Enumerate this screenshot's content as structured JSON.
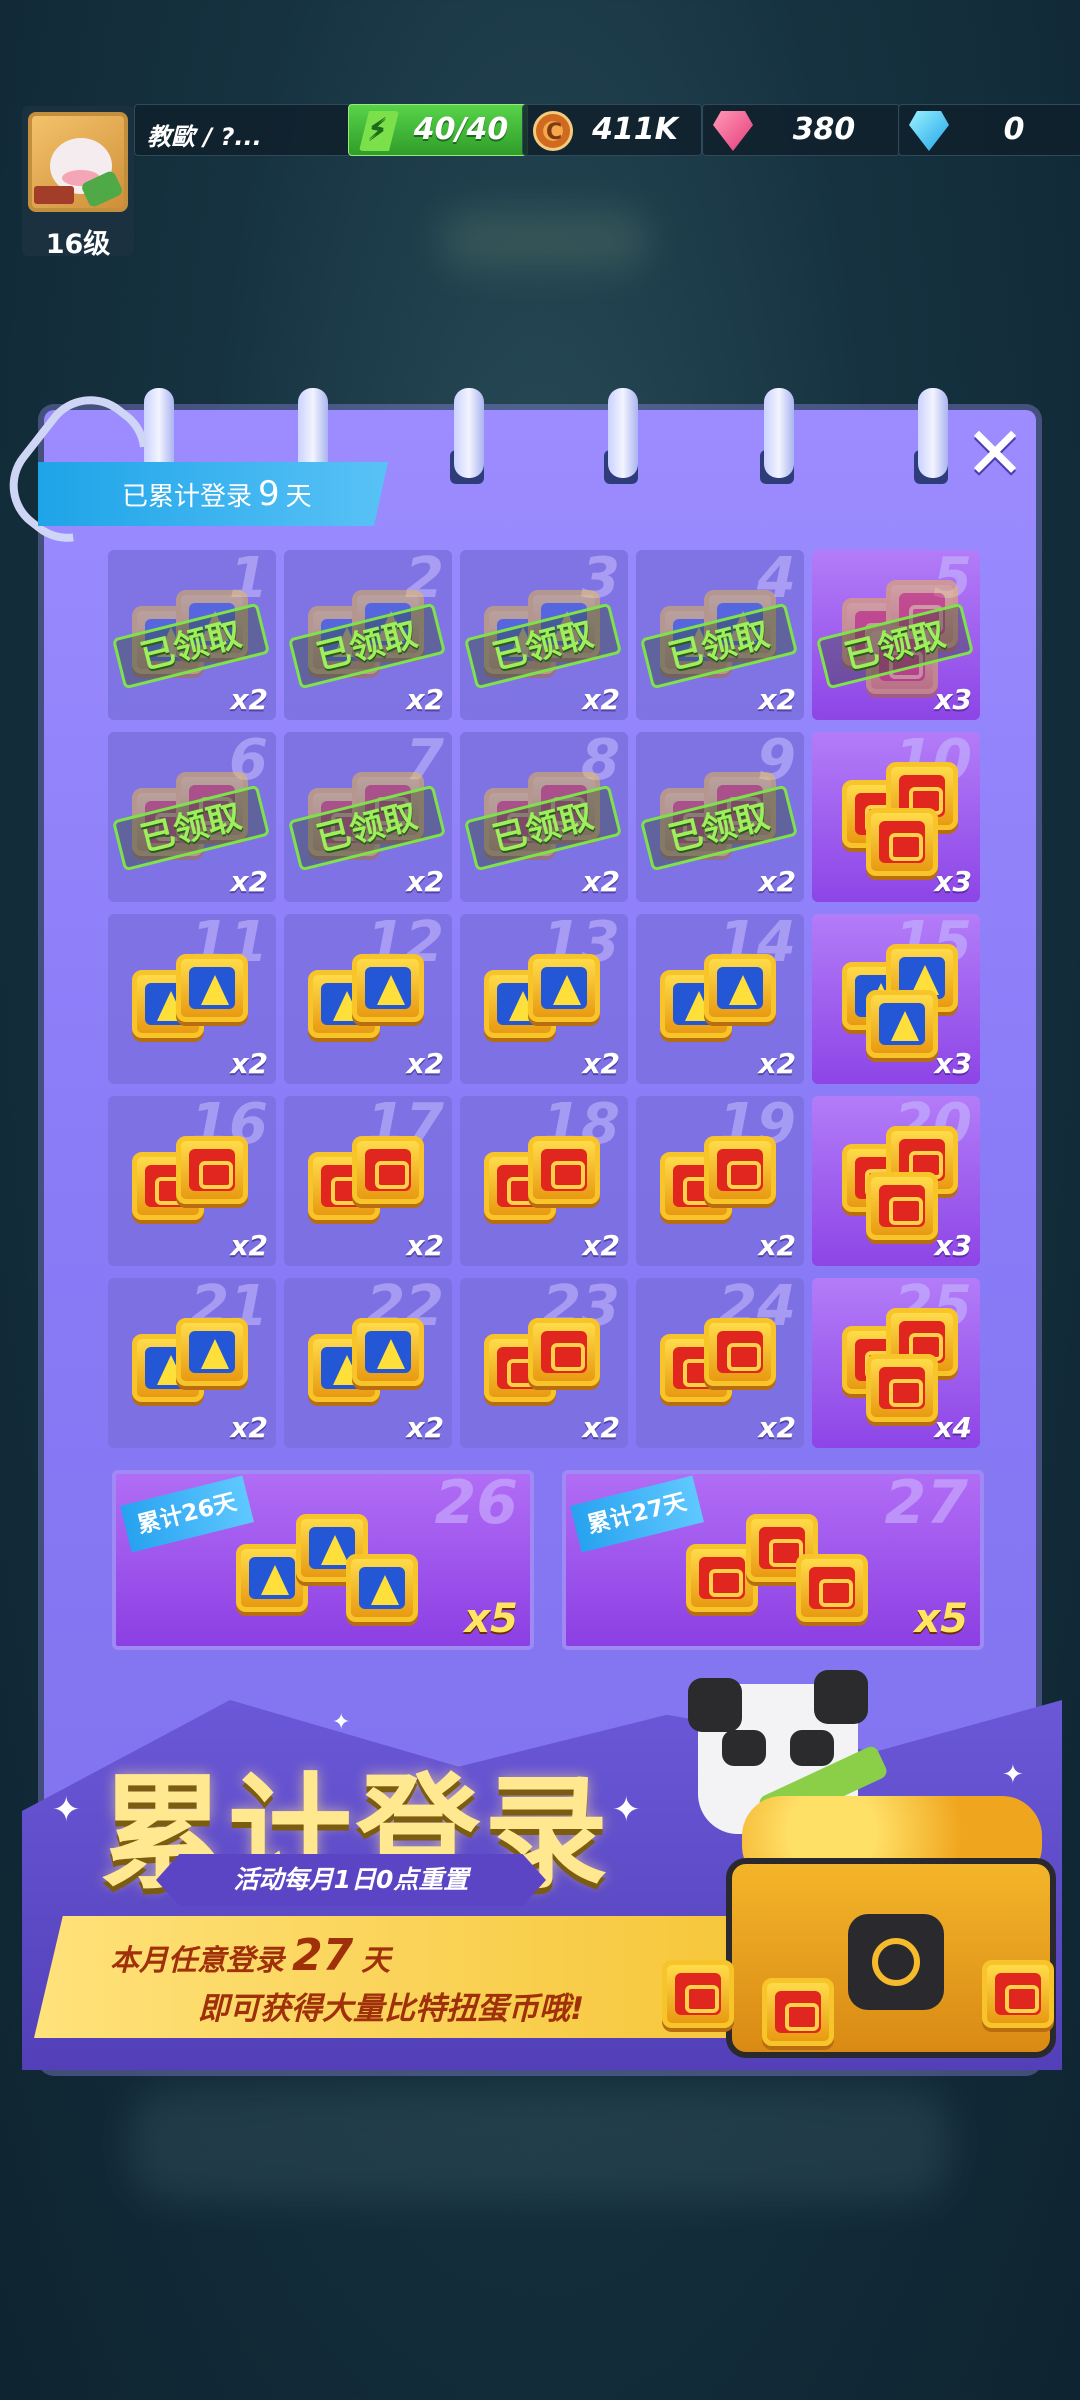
{
  "hud": {
    "player_name": "教歐 / ?...",
    "level": "16级",
    "energy": "40/40",
    "coins": "411K",
    "gems": "380",
    "diamonds": "0"
  },
  "panel": {
    "login_label_prefix": "已累计登录",
    "login_days": "9",
    "login_label_suffix": "天",
    "close_symbol": "✕",
    "claimed_label": "已领取",
    "days": [
      {
        "day": "1",
        "qty": "x2",
        "box": "blue",
        "claimed": true,
        "special": false
      },
      {
        "day": "2",
        "qty": "x2",
        "box": "blue",
        "claimed": true,
        "special": false
      },
      {
        "day": "3",
        "qty": "x2",
        "box": "blue",
        "claimed": true,
        "special": false
      },
      {
        "day": "4",
        "qty": "x2",
        "box": "blue",
        "claimed": true,
        "special": false
      },
      {
        "day": "5",
        "qty": "x3",
        "box": "red",
        "claimed": true,
        "special": true
      },
      {
        "day": "6",
        "qty": "x2",
        "box": "red",
        "claimed": true,
        "special": false
      },
      {
        "day": "7",
        "qty": "x2",
        "box": "red",
        "claimed": true,
        "special": false
      },
      {
        "day": "8",
        "qty": "x2",
        "box": "red",
        "claimed": true,
        "special": false
      },
      {
        "day": "9",
        "qty": "x2",
        "box": "red",
        "claimed": true,
        "special": false
      },
      {
        "day": "10",
        "qty": "x3",
        "box": "red",
        "claimed": false,
        "special": true
      },
      {
        "day": "11",
        "qty": "x2",
        "box": "blue",
        "claimed": false,
        "special": false
      },
      {
        "day": "12",
        "qty": "x2",
        "box": "blue",
        "claimed": false,
        "special": false
      },
      {
        "day": "13",
        "qty": "x2",
        "box": "blue",
        "claimed": false,
        "special": false
      },
      {
        "day": "14",
        "qty": "x2",
        "box": "blue",
        "claimed": false,
        "special": false
      },
      {
        "day": "15",
        "qty": "x3",
        "box": "blue",
        "claimed": false,
        "special": true
      },
      {
        "day": "16",
        "qty": "x2",
        "box": "red",
        "claimed": false,
        "special": false
      },
      {
        "day": "17",
        "qty": "x2",
        "box": "red",
        "claimed": false,
        "special": false
      },
      {
        "day": "18",
        "qty": "x2",
        "box": "red",
        "claimed": false,
        "special": false
      },
      {
        "day": "19",
        "qty": "x2",
        "box": "red",
        "claimed": false,
        "special": false
      },
      {
        "day": "20",
        "qty": "x3",
        "box": "red",
        "claimed": false,
        "special": true
      },
      {
        "day": "21",
        "qty": "x2",
        "box": "blue",
        "claimed": false,
        "special": false
      },
      {
        "day": "22",
        "qty": "x2",
        "box": "blue",
        "claimed": false,
        "special": false
      },
      {
        "day": "23",
        "qty": "x2",
        "box": "red",
        "claimed": false,
        "special": false
      },
      {
        "day": "24",
        "qty": "x2",
        "box": "red",
        "claimed": false,
        "special": false
      },
      {
        "day": "25",
        "qty": "x4",
        "box": "red",
        "claimed": false,
        "special": true
      }
    ],
    "big_rewards": [
      {
        "day": "26",
        "tag": "累计26天",
        "qty": "x5",
        "box": "blue"
      },
      {
        "day": "27",
        "tag": "累计27天",
        "qty": "x5",
        "box": "red"
      }
    ]
  },
  "banner": {
    "title": "累计登录",
    "reset_note": "活动每月1日0点重置",
    "line1_prefix": "本月任意登录",
    "line1_days": "27",
    "line1_suffix": "天",
    "line2": "即可获得大量比特扭蛋币哦!"
  },
  "icons": {
    "energy": "lightning-icon",
    "coin": "coin-icon",
    "gem": "pink-gem-icon",
    "diamond": "blue-diamond-icon",
    "close": "close-icon",
    "blue_box": "blue-capsule-box-icon",
    "red_box": "red-capsule-box-icon"
  },
  "colors": {
    "panel": "#8a7bf7",
    "special_cell": "#9a58ee",
    "claimed_stamp": "#7ee24a",
    "login_tag": "#1ea4e8",
    "title_text": "#ffe88f"
  }
}
